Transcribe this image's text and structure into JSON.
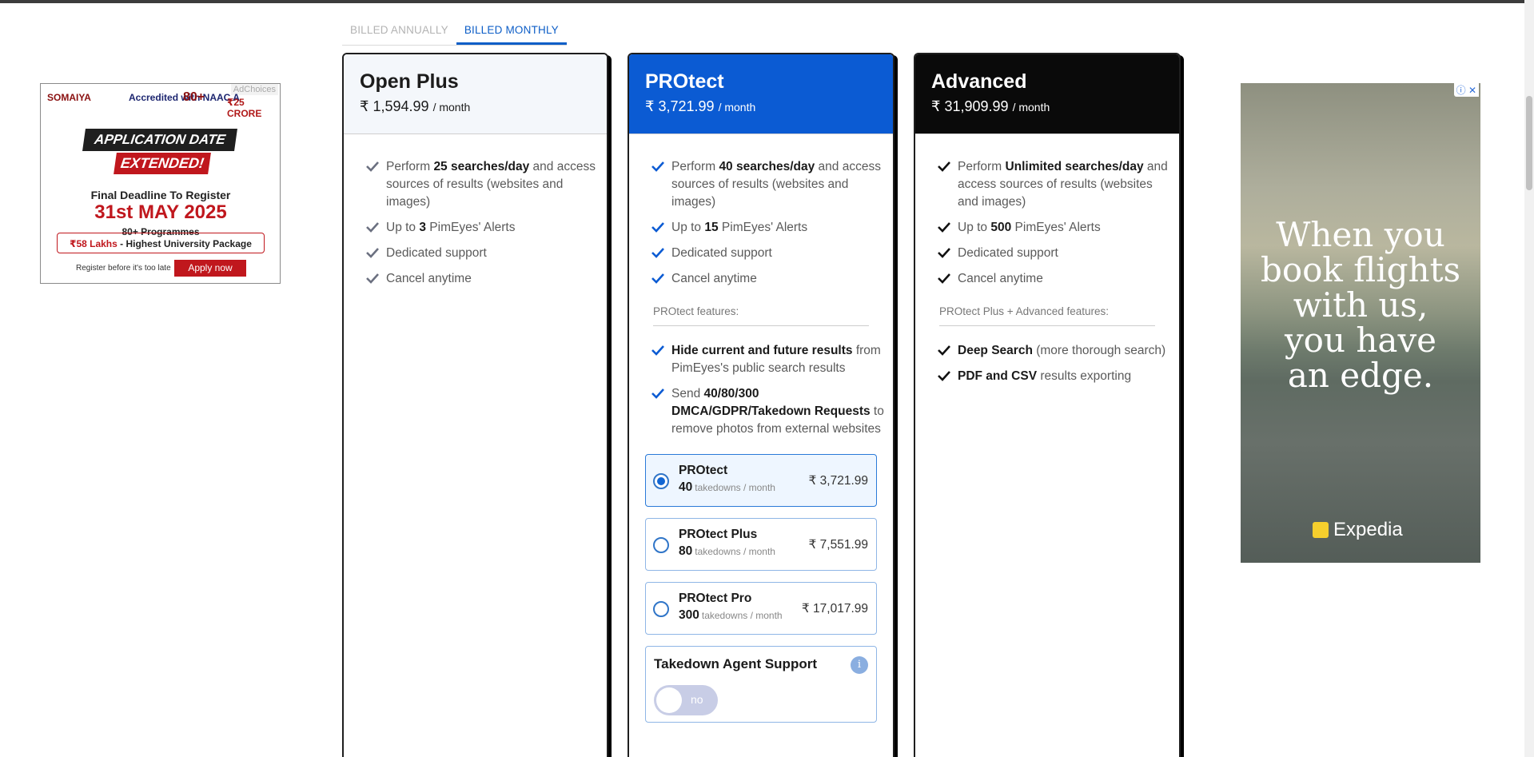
{
  "tabs": [
    {
      "label": "BILLED ANNUALLY",
      "active": false
    },
    {
      "label": "BILLED MONTHLY",
      "active": true
    }
  ],
  "plans": {
    "open": {
      "name": "Open Plus",
      "currency": "₹",
      "price": "1,594.99",
      "per": "/ month",
      "features": [
        {
          "pre": "Perform ",
          "bold": "25 searches/day",
          "post": " and access sources of results (websites and images)"
        },
        {
          "pre": "Up to ",
          "bold": "3",
          "post": " PimEyes' Alerts"
        },
        {
          "pre": "",
          "bold": "",
          "post": "Dedicated support"
        },
        {
          "pre": "",
          "bold": "",
          "post": "Cancel anytime"
        }
      ]
    },
    "pro": {
      "name": "PROtect",
      "currency": "₹",
      "price": "3,721.99",
      "per": "/ month",
      "features": [
        {
          "pre": "Perform ",
          "bold": "40 searches/day",
          "post": " and access sources of results (websites and images)"
        },
        {
          "pre": "Up to ",
          "bold": "15",
          "post": " PimEyes' Alerts"
        },
        {
          "pre": "",
          "bold": "",
          "post": "Dedicated support"
        },
        {
          "pre": "",
          "bold": "",
          "post": "Cancel anytime"
        }
      ],
      "section_label": "PROtect features:",
      "extra": [
        {
          "pre": "",
          "bold": "Hide current and future results",
          "post": " from PimEyes's public search results"
        },
        {
          "pre": "Send ",
          "bold": "40/80/300 DMCA/GDPR/Takedown Requests",
          "post": " to remove photos from external websites"
        }
      ],
      "options": [
        {
          "name": "PROtect",
          "count": "40",
          "unit": "takedowns / month",
          "price": "₹ 3,721.99",
          "selected": true
        },
        {
          "name": "PROtect Plus",
          "count": "80",
          "unit": "takedowns / month",
          "price": "₹ 7,551.99",
          "selected": false
        },
        {
          "name": "PROtect Pro",
          "count": "300",
          "unit": "takedowns / month",
          "price": "₹ 17,017.99",
          "selected": false
        }
      ],
      "takedown_agent": {
        "title": "Takedown Agent Support",
        "info": "i",
        "toggle": "no"
      }
    },
    "adv": {
      "name": "Advanced",
      "currency": "₹",
      "price": "31,909.99",
      "per": "/ month",
      "features": [
        {
          "pre": "Perform ",
          "bold": "Unlimited searches/day",
          "post": " and access sources of results (websites and images)"
        },
        {
          "pre": "Up to ",
          "bold": "500",
          "post": " PimEyes' Alerts"
        },
        {
          "pre": "",
          "bold": "",
          "post": "Dedicated support"
        },
        {
          "pre": "",
          "bold": "",
          "post": "Cancel anytime"
        }
      ],
      "section_label": "PROtect Plus + Advanced features:",
      "extra": [
        {
          "pre": "",
          "bold": "Deep Search",
          "post": " (more thorough search)"
        },
        {
          "pre": "",
          "bold": "PDF and CSV",
          "post": " results exporting"
        }
      ]
    }
  },
  "ad_left": {
    "choices": "AdChoices",
    "brand": "SOMAIYA",
    "accred": "Accredited with NAAC A",
    "years": "80+",
    "scholarships": "₹25 CRORE",
    "banner1": "APPLICATION DATE",
    "banner2": "EXTENDED!",
    "deadline": "Final Deadline To Register",
    "date": "31st MAY 2025",
    "programmes": "80+ Programmes",
    "package_amount": "₹58 Lakhs",
    "package_text": " - Highest University Package",
    "register": "Register before it's too late",
    "apply": "Apply now"
  },
  "ad_right": {
    "text": [
      "When you",
      "book flights",
      "with us,",
      "you have",
      "an edge."
    ],
    "brand": "Expedia"
  }
}
